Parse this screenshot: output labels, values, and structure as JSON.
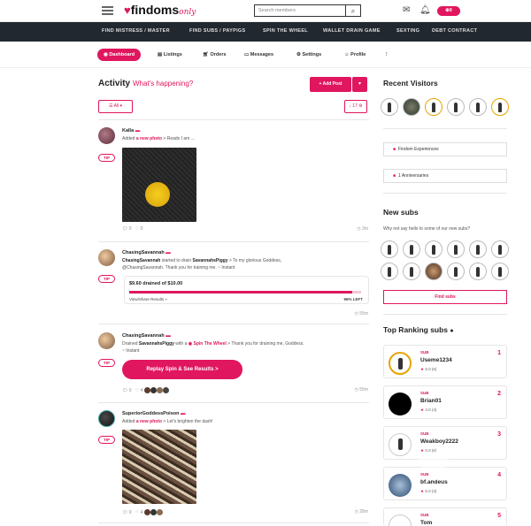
{
  "header": {
    "logo_text": "findoms",
    "logo_suffix": "only",
    "search_placeholder": "Search members",
    "credits_badge": "0"
  },
  "nav": [
    "FIND MISTRESS / MASTER",
    "FIND SUBS / PAYPIGS",
    "SPIN THE WHEEL",
    "WALLET DRAIN GAME",
    "SEXTING",
    "DEBT CONTRACT"
  ],
  "tabs": [
    "Dashboard",
    "Listings",
    "Orders",
    "Messages",
    "Settings",
    "Profile"
  ],
  "activity": {
    "title": "Activity",
    "subtitle": "What's happening?",
    "add_post": "+ Add Post",
    "filter_all": "All",
    "filter_count": "17"
  },
  "posts": [
    {
      "name": "Kalla",
      "text_pre": "Added ",
      "text_link": "a new photo",
      "text_post": " > Reads I am ...",
      "comments": "0",
      "likes": "0",
      "ago": "3m",
      "tip": "TIP"
    },
    {
      "name": "ChasingSavannah",
      "actor": "ChasingSavannah",
      "text_mid": " started to drain ",
      "target": "SavannahsPiggy",
      "text_post": " > To my glorious Goddess,",
      "line2": "@ChasingSavannah. Thank you for training me. ~ Instant",
      "drain_amount": "$9.60 drained of $10.00",
      "drain_fraction": 0.96,
      "drain_link": "View/Share Results »",
      "drain_left": "96% LEFT",
      "ago": "55m",
      "tip": "TIP"
    },
    {
      "name": "ChasingSavannah",
      "text_pre": "Drained ",
      "target": "SavannahsPiggy",
      "text_mid": " with a ",
      "link": "Spin The Wheel",
      "text_post": " > Thank you for draining me, Goddess.",
      "line2": "~ Instant",
      "replay": "Replay Spin & See Results  >",
      "comments": "0",
      "likes": "4",
      "ago": "55m",
      "tip": "TIP"
    },
    {
      "name": "SuperiorGoddessPoison",
      "text_pre": "Added ",
      "text_link": "a new photo",
      "text_post": " > Let's brighten the dash!",
      "comments": "0",
      "likes": "4",
      "ago": "28m",
      "tip": "TIP"
    }
  ],
  "sidebar": {
    "recent_visitors": "Recent Visitors",
    "findom_experiences": "Findom Experiences",
    "anniversaries": "1 Anniversaries",
    "new_subs_title": "New subs",
    "new_subs_sub": "Why not say hello to some of our new subs?",
    "find_subs": "Find subs",
    "top_ranking": "Top Ranking subs",
    "ranking": [
      {
        "tag": "SUB",
        "name": "Useme1234",
        "rating": "5.0 (6)",
        "pos": "1"
      },
      {
        "tag": "SUB",
        "name": "Brian01",
        "rating": "4.0 (4)",
        "pos": "2"
      },
      {
        "tag": "SUB",
        "name": "Weakboy2222",
        "rating": "5.0 (6)",
        "pos": "3"
      },
      {
        "tag": "SUB",
        "name": "bf.andeus",
        "rating": "5.0 (3)",
        "pos": "4"
      },
      {
        "tag": "SUB",
        "name": "Tom",
        "rating": "5.0 (4)",
        "pos": "5"
      }
    ]
  },
  "colors": {
    "accent": "#e0165e",
    "nav_bg": "#222830"
  }
}
